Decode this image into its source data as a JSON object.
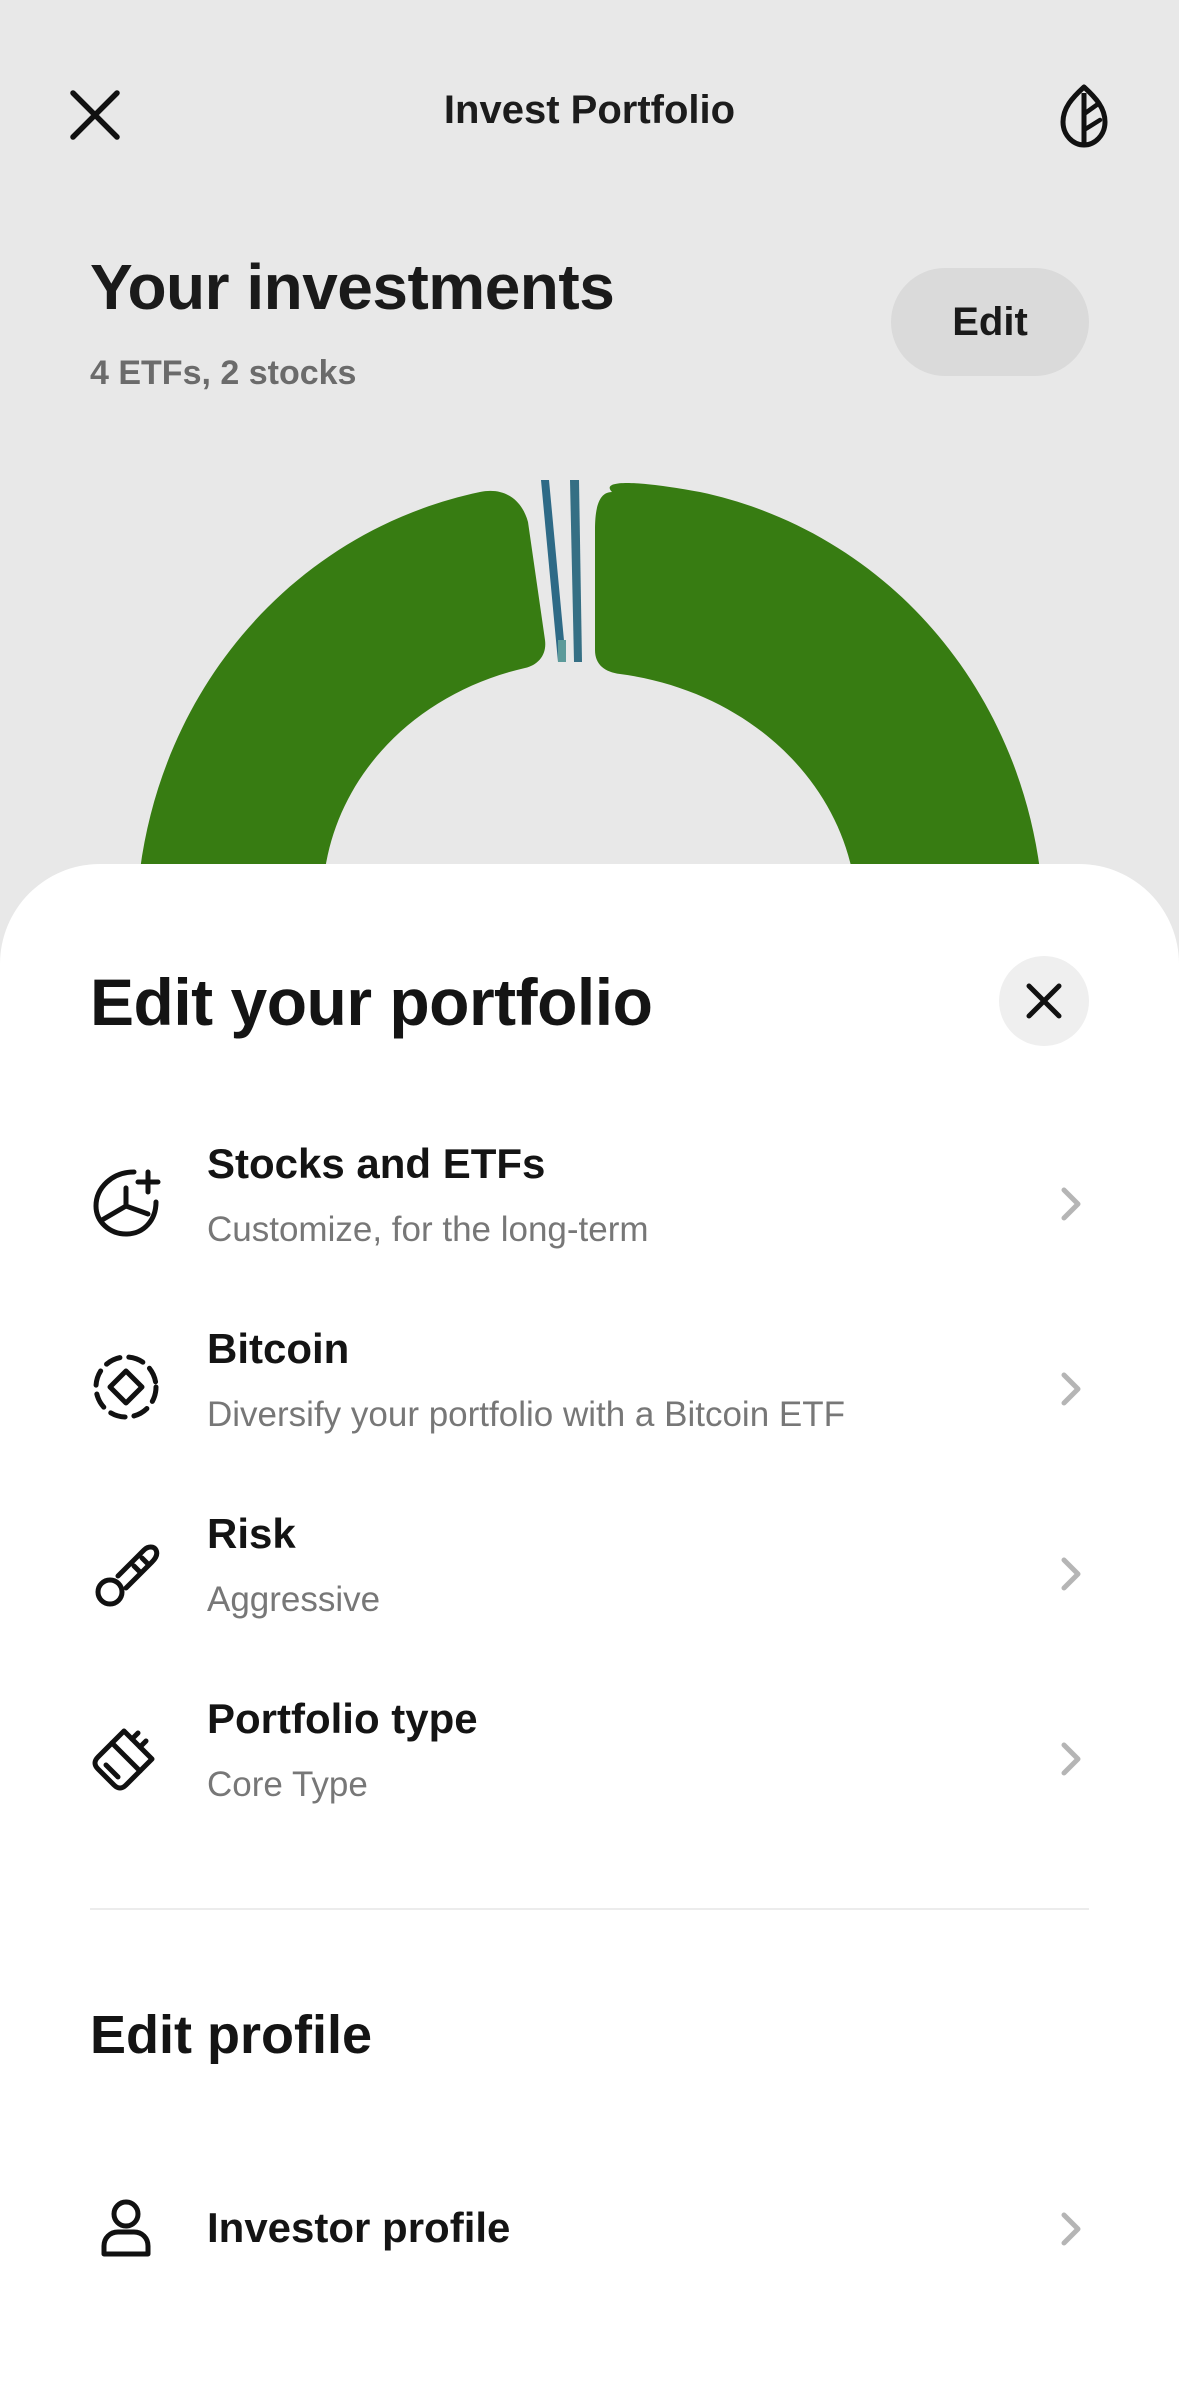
{
  "header": {
    "title": "Invest Portfolio",
    "close_icon": "close-icon",
    "leaf_icon": "leaf-icon"
  },
  "investments": {
    "title": "Your investments",
    "subtitle": "4 ETFs, 2 stocks",
    "edit_label": "Edit"
  },
  "allocation_chart": {
    "colors": {
      "primary": "#377c12",
      "secondary": "#2e6a86",
      "tertiary": "#5c9a9a"
    }
  },
  "sheet": {
    "title": "Edit your portfolio",
    "close_icon": "close-icon",
    "items": [
      {
        "label": "Stocks and ETFs",
        "description": "Customize, for the long-term",
        "icon": "pie-chart-plus-icon"
      },
      {
        "label": "Bitcoin",
        "description": "Diversify your portfolio with a Bitcoin ETF",
        "icon": "bitcoin-diamond-icon"
      },
      {
        "label": "Risk",
        "description": "Aggressive",
        "icon": "thermometer-icon"
      },
      {
        "label": "Portfolio type",
        "description": "Core Type",
        "icon": "paintbrush-icon"
      }
    ],
    "profile_section": {
      "title": "Edit profile",
      "items": [
        {
          "label": "Investor profile",
          "icon": "person-icon"
        }
      ]
    }
  },
  "theme": {
    "background": "#e8e8e8",
    "sheet_background": "#ffffff",
    "accent_green": "#377c12",
    "text_primary": "#141414",
    "text_secondary": "#777777",
    "chevron": "#b5b5b5"
  }
}
